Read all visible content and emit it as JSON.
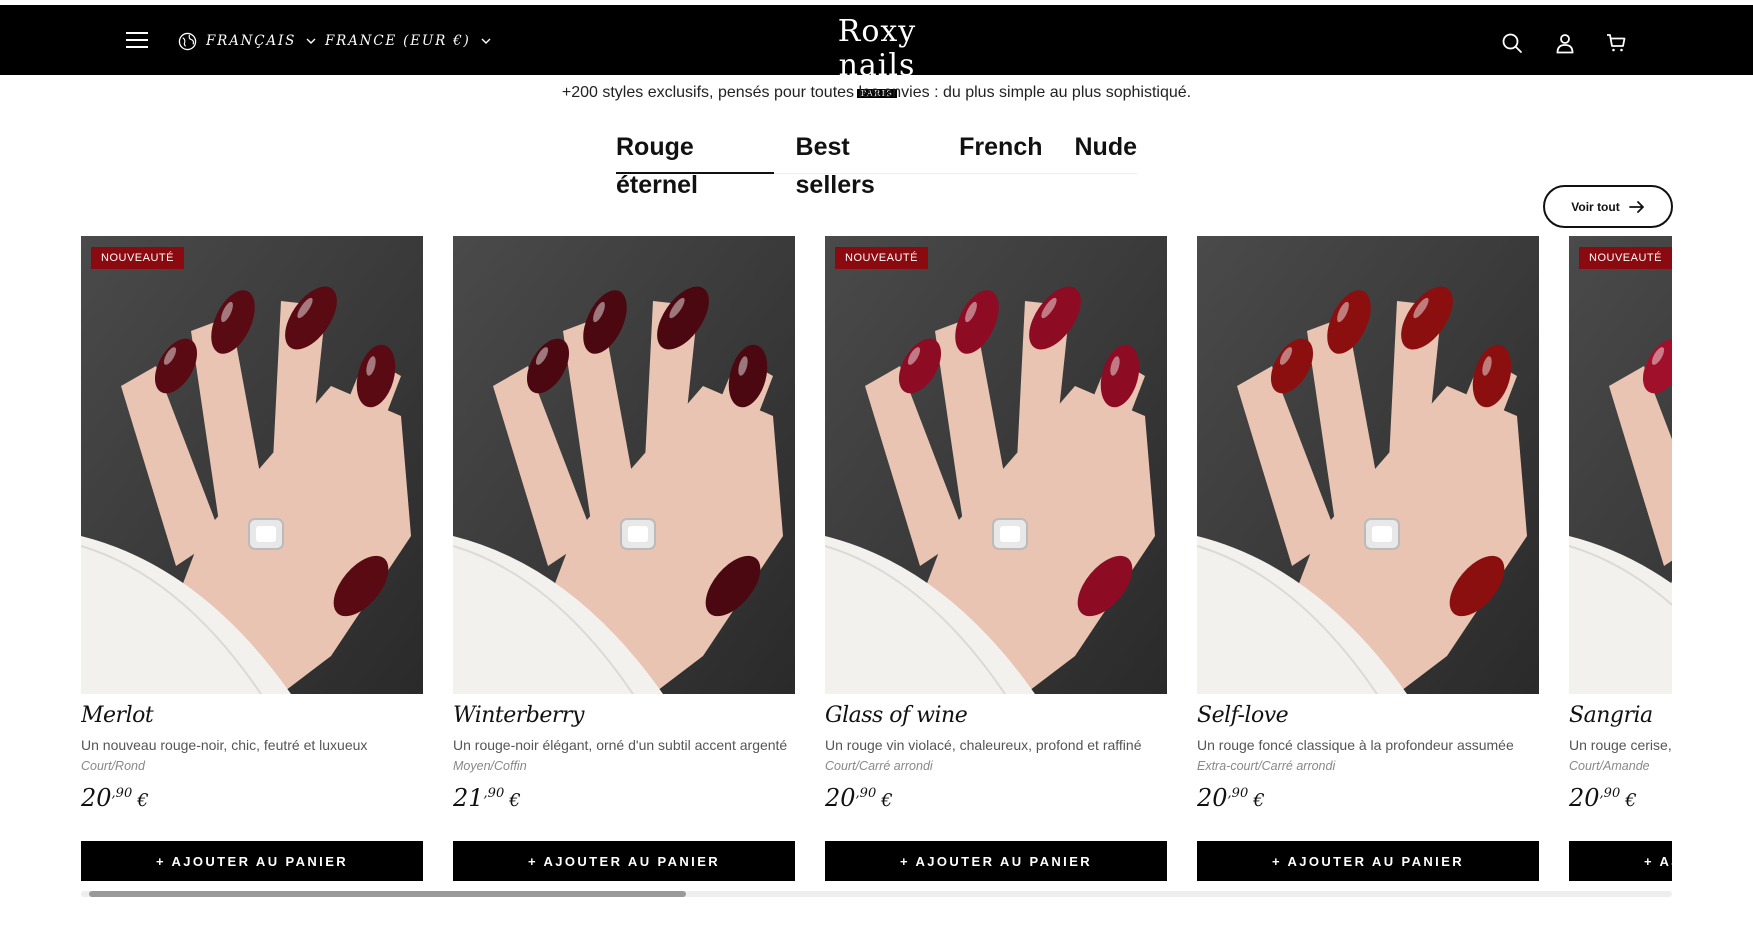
{
  "header": {
    "language": "FRANÇAIS",
    "country": "FRANCE (EUR €)",
    "logo_main": "Roxy nails",
    "logo_sub": "PARIS"
  },
  "section": {
    "subtitle": "+200 styles exclusifs, pensés pour toutes les envies : du plus simple au plus sophistiqué.",
    "tabs": [
      "Rouge éternel",
      "Best sellers",
      "French",
      "Nude"
    ],
    "active_tab": "Rouge éternel",
    "view_all": "Voir tout"
  },
  "products": [
    {
      "badge": "NOUVEAUTÉ",
      "name": "Merlot",
      "desc": "Un nouveau rouge-noir, chic, feutré et luxueux",
      "shape": "Court/Rond",
      "price_int": "20",
      "price_dec": ",90",
      "currency": "€",
      "button": "+ AJOUTER AU PANIER",
      "nail_color": "#5a0a12"
    },
    {
      "badge": "",
      "name": "Winterberry",
      "desc": "Un rouge-noir élégant, orné d'un subtil accent argenté",
      "shape": "Moyen/Coffin",
      "price_int": "21",
      "price_dec": ",90",
      "currency": "€",
      "button": "+ AJOUTER AU PANIER",
      "nail_color": "#4b0810"
    },
    {
      "badge": "NOUVEAUTÉ",
      "name": "Glass of wine",
      "desc": "Un rouge vin violacé, chaleureux, profond et raffiné",
      "shape": "Court/Carré arrondi",
      "price_int": "20",
      "price_dec": ",90",
      "currency": "€",
      "button": "+ AJOUTER AU PANIER",
      "nail_color": "#8e0b24"
    },
    {
      "badge": "",
      "name": "Self-love",
      "desc": "Un rouge foncé classique à la profondeur assumée",
      "shape": "Extra-court/Carré arrondi",
      "price_int": "20",
      "price_dec": ",90",
      "currency": "€",
      "button": "+ AJOUTER AU PANIER",
      "nail_color": "#8c0f10"
    },
    {
      "badge": "NOUVEAUTÉ",
      "name": "Sangria",
      "desc": "Un rouge cerise, lumineux, aux reflets élégantes",
      "shape": "Court/Amande",
      "price_int": "20",
      "price_dec": ",90",
      "currency": "€",
      "button": "+ AJOUTER AU PANIER",
      "nail_color": "#a0102a"
    }
  ],
  "colors": {
    "header_bg": "#000000",
    "badge_bg": "#8b0a10",
    "button_bg": "#000000",
    "photo_bg": "#3b3b3b",
    "sleeve": "#f2f1ee",
    "skin": "#e9c4b2"
  },
  "scroll": {
    "position_fraction": 0.37
  }
}
